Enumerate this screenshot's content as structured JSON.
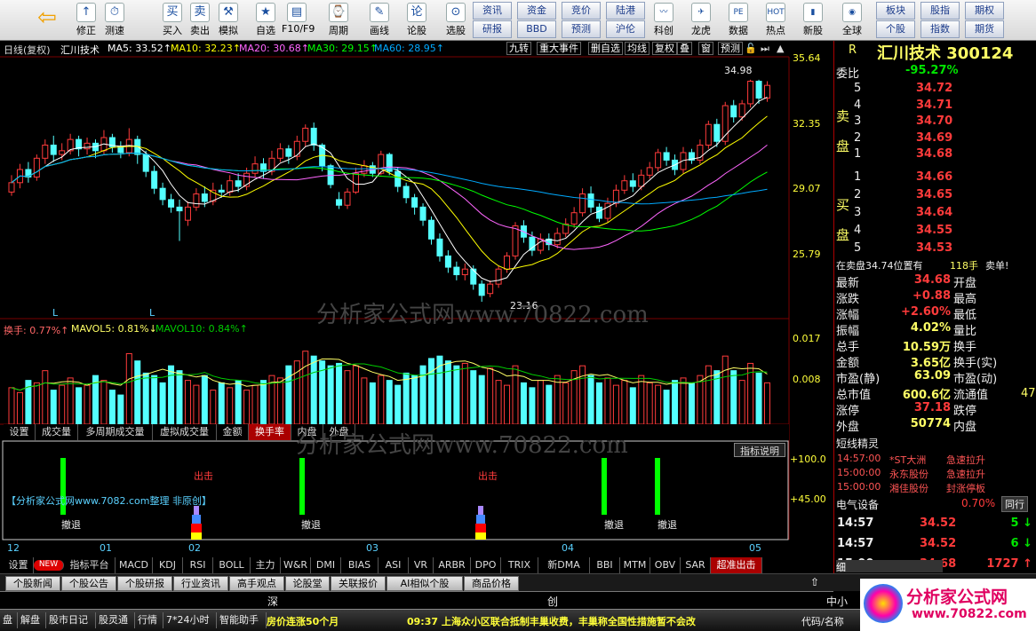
{
  "toolbar": {
    "left": [
      {
        "t": "修正",
        "i": "↑"
      },
      {
        "t": "测速",
        "i": "⏱"
      },
      {
        "t": "买入",
        "i": "买"
      },
      {
        "t": "卖出",
        "i": "卖"
      },
      {
        "t": "模拟",
        "i": "⚒"
      },
      {
        "t": "自选",
        "i": "★"
      },
      {
        "t": "F10/F9",
        "i": "▤"
      },
      {
        "t": "周期",
        "i": "⌚"
      },
      {
        "t": "画线",
        "i": "✎"
      },
      {
        "t": "论股",
        "i": "论"
      },
      {
        "t": "选股",
        "i": "⊙"
      }
    ],
    "btns": [
      "资讯",
      "资金",
      "竞价",
      "陆港",
      "研报",
      "BBD",
      "预测",
      "沪伦"
    ],
    "right": [
      {
        "t": "科创",
        "i": "〰"
      },
      {
        "t": "龙虎",
        "i": "✈"
      },
      {
        "t": "数据",
        "i": "PE"
      },
      {
        "t": "热点",
        "i": "HOT"
      },
      {
        "t": "新股",
        "i": "▮"
      },
      {
        "t": "全球",
        "i": "◉"
      }
    ],
    "btns2": [
      "板块",
      "股指",
      "期权",
      "个股",
      "指数",
      "期货"
    ]
  },
  "chart": {
    "header": {
      "title": "日线(复权)",
      "stock": "汇川技术",
      "ma5": "MA5: 33.52↑",
      "ma10": "MA10: 32.23↑",
      "ma20": "MA20: 30.68↑",
      "ma30": "MA30: 29.15↑",
      "ma60": "MA60: 28.95↑"
    },
    "top_btns": [
      "九转",
      "重大事件",
      "删自选",
      "均线",
      "复权",
      "叠",
      "窗",
      "预测"
    ],
    "price_ticks": [
      "35.64",
      "32.35",
      "29.07",
      "25.79"
    ],
    "hi_label": "34.98",
    "lo_label": "23.16",
    "watermark": "分析家公式网www.70822.com",
    "vol_header": {
      "a": "换手: 0.77%↑",
      "b": "MAVOL5: 0.81%↓",
      "c": "MAVOL10: 0.84%↑"
    },
    "vol_ticks": [
      "0.017",
      "0.008"
    ],
    "vol_tabs": [
      "设置",
      "成交量",
      "多周期成交量",
      "虚拟成交量",
      "金额",
      "换手率",
      "内盘",
      "外盘"
    ],
    "ind_button": "指标说明",
    "ind_ticks": [
      "+100.0",
      "+45.00"
    ],
    "ind_text": "【分析家公式网www.7082.com整理 非原创】",
    "ind_signals": [
      {
        "t": "撤退"
      },
      {
        "t": "撤退"
      },
      {
        "t": "撤退"
      },
      {
        "t": "撤退"
      }
    ],
    "exit_label": "出击",
    "months": [
      "12",
      "01",
      "02",
      "03",
      "04",
      "05"
    ],
    "ind_tabs": [
      "设置",
      "NEW",
      "指标平台",
      "MACD",
      "KDJ",
      "RSI",
      "BOLL",
      "主力",
      "W&R",
      "DMI",
      "BIAS",
      "ASI",
      "VR",
      "ARBR",
      "DPO",
      "TRIX",
      "新DMA",
      "BBI",
      "MTM",
      "OBV",
      "SAR",
      "超准出击"
    ]
  },
  "chart_data": {
    "type": "candlestick",
    "candles": [
      {
        "o": 29.0,
        "c": 29.5,
        "h": 29.9,
        "l": 28.8
      },
      {
        "o": 29.5,
        "c": 30.2,
        "h": 30.5,
        "l": 29.2
      },
      {
        "o": 30.2,
        "c": 29.8,
        "h": 30.6,
        "l": 29.5
      },
      {
        "o": 29.8,
        "c": 30.8,
        "h": 31.0,
        "l": 29.6
      },
      {
        "o": 30.8,
        "c": 31.5,
        "h": 31.8,
        "l": 30.5
      },
      {
        "o": 31.5,
        "c": 31.0,
        "h": 32.0,
        "l": 30.6
      },
      {
        "o": 31.0,
        "c": 31.2,
        "h": 31.6,
        "l": 30.7
      },
      {
        "o": 31.2,
        "c": 31.8,
        "h": 32.1,
        "l": 31.0
      },
      {
        "o": 31.8,
        "c": 31.3,
        "h": 32.0,
        "l": 30.9
      },
      {
        "o": 31.3,
        "c": 31.6,
        "h": 31.9,
        "l": 31.0
      },
      {
        "o": 31.6,
        "c": 31.2,
        "h": 31.8,
        "l": 30.8
      },
      {
        "o": 31.2,
        "c": 31.9,
        "h": 32.3,
        "l": 31.0
      },
      {
        "o": 31.9,
        "c": 31.4,
        "h": 32.1,
        "l": 31.1
      },
      {
        "o": 31.4,
        "c": 31.1,
        "h": 31.7,
        "l": 30.8
      },
      {
        "o": 31.1,
        "c": 31.8,
        "h": 32.4,
        "l": 30.9
      },
      {
        "o": 31.8,
        "c": 31.0,
        "h": 32.0,
        "l": 30.5
      },
      {
        "o": 31.0,
        "c": 30.1,
        "h": 31.2,
        "l": 29.8
      },
      {
        "o": 30.1,
        "c": 29.2,
        "h": 30.4,
        "l": 28.9
      },
      {
        "o": 29.2,
        "c": 28.6,
        "h": 29.5,
        "l": 28.3
      },
      {
        "o": 28.6,
        "c": 28.2,
        "h": 28.9,
        "l": 27.9
      },
      {
        "o": 28.2,
        "c": 28.0,
        "h": 28.6,
        "l": 26.4
      },
      {
        "o": 27.5,
        "c": 28.2,
        "h": 28.5,
        "l": 27.2
      },
      {
        "o": 28.2,
        "c": 28.9,
        "h": 29.2,
        "l": 28.0
      },
      {
        "o": 28.9,
        "c": 28.5,
        "h": 29.3,
        "l": 28.2
      },
      {
        "o": 28.5,
        "c": 29.1,
        "h": 29.5,
        "l": 28.3
      },
      {
        "o": 29.1,
        "c": 29.0,
        "h": 29.4,
        "l": 28.7
      },
      {
        "o": 29.0,
        "c": 29.6,
        "h": 29.9,
        "l": 28.8
      },
      {
        "o": 29.6,
        "c": 29.3,
        "h": 30.0,
        "l": 29.0
      },
      {
        "o": 29.3,
        "c": 30.0,
        "h": 30.3,
        "l": 29.1
      },
      {
        "o": 30.0,
        "c": 30.5,
        "h": 30.9,
        "l": 29.8
      },
      {
        "o": 30.5,
        "c": 30.1,
        "h": 30.8,
        "l": 29.7
      },
      {
        "o": 30.1,
        "c": 30.8,
        "h": 31.2,
        "l": 29.9
      },
      {
        "o": 30.8,
        "c": 31.3,
        "h": 31.6,
        "l": 30.6
      },
      {
        "o": 31.3,
        "c": 30.9,
        "h": 31.5,
        "l": 30.5
      },
      {
        "o": 30.9,
        "c": 31.7,
        "h": 32.0,
        "l": 30.7
      },
      {
        "o": 31.7,
        "c": 32.4,
        "h": 32.6,
        "l": 31.4
      },
      {
        "o": 32.4,
        "c": 31.5,
        "h": 32.7,
        "l": 31.2
      },
      {
        "o": 31.5,
        "c": 30.4,
        "h": 31.6,
        "l": 30.1
      },
      {
        "o": 30.4,
        "c": 29.4,
        "h": 30.5,
        "l": 29.2
      },
      {
        "o": 28.6,
        "c": 28.3,
        "h": 29.0,
        "l": 28.1
      },
      {
        "o": 28.3,
        "c": 29.0,
        "h": 29.2,
        "l": 28.1
      },
      {
        "o": 29.0,
        "c": 30.0,
        "h": 30.3,
        "l": 28.9
      },
      {
        "o": 30.0,
        "c": 30.4,
        "h": 30.7,
        "l": 29.8
      },
      {
        "o": 30.4,
        "c": 30.0,
        "h": 30.6,
        "l": 29.8
      },
      {
        "o": 30.0,
        "c": 31.0,
        "h": 31.2,
        "l": 29.9
      },
      {
        "o": 31.0,
        "c": 30.1,
        "h": 31.1,
        "l": 29.9
      },
      {
        "o": 30.1,
        "c": 29.3,
        "h": 30.3,
        "l": 29.0
      },
      {
        "o": 29.3,
        "c": 28.7,
        "h": 29.5,
        "l": 28.4
      },
      {
        "o": 28.7,
        "c": 28.2,
        "h": 28.9,
        "l": 27.8
      },
      {
        "o": 28.2,
        "c": 27.5,
        "h": 28.4,
        "l": 27.2
      },
      {
        "o": 27.5,
        "c": 26.5,
        "h": 27.7,
        "l": 26.2
      },
      {
        "o": 26.5,
        "c": 25.6,
        "h": 26.8,
        "l": 25.3
      },
      {
        "o": 25.6,
        "c": 25.0,
        "h": 25.9,
        "l": 24.7
      },
      {
        "o": 25.0,
        "c": 24.6,
        "h": 25.3,
        "l": 24.3
      },
      {
        "o": 24.6,
        "c": 24.9,
        "h": 25.2,
        "l": 24.3
      },
      {
        "o": 24.9,
        "c": 24.1,
        "h": 25.1,
        "l": 23.8
      },
      {
        "o": 24.1,
        "c": 23.5,
        "h": 24.3,
        "l": 23.16
      },
      {
        "o": 23.6,
        "c": 24.1,
        "h": 24.3,
        "l": 23.4
      },
      {
        "o": 24.1,
        "c": 24.9,
        "h": 25.1,
        "l": 23.9
      },
      {
        "o": 24.9,
        "c": 25.6,
        "h": 25.8,
        "l": 24.7
      },
      {
        "o": 25.6,
        "c": 27.2,
        "h": 27.4,
        "l": 25.4
      },
      {
        "o": 27.2,
        "c": 26.6,
        "h": 27.5,
        "l": 26.3
      },
      {
        "o": 26.6,
        "c": 25.9,
        "h": 26.9,
        "l": 25.6
      },
      {
        "o": 25.9,
        "c": 26.5,
        "h": 26.8,
        "l": 25.7
      },
      {
        "o": 26.5,
        "c": 26.2,
        "h": 26.8,
        "l": 25.9
      },
      {
        "o": 26.2,
        "c": 26.8,
        "h": 27.1,
        "l": 26.0
      },
      {
        "o": 26.8,
        "c": 27.3,
        "h": 27.6,
        "l": 26.6
      },
      {
        "o": 27.3,
        "c": 27.9,
        "h": 28.2,
        "l": 27.1
      },
      {
        "o": 27.9,
        "c": 28.9,
        "h": 29.2,
        "l": 27.7
      },
      {
        "o": 28.9,
        "c": 28.2,
        "h": 29.3,
        "l": 27.9
      },
      {
        "o": 28.2,
        "c": 27.6,
        "h": 28.4,
        "l": 27.4
      },
      {
        "o": 27.6,
        "c": 28.4,
        "h": 28.7,
        "l": 27.4
      },
      {
        "o": 28.4,
        "c": 29.1,
        "h": 29.4,
        "l": 28.2
      },
      {
        "o": 29.1,
        "c": 29.6,
        "h": 29.9,
        "l": 28.9
      },
      {
        "o": 29.6,
        "c": 29.3,
        "h": 30.0,
        "l": 29.0
      },
      {
        "o": 29.3,
        "c": 29.9,
        "h": 30.2,
        "l": 29.1
      },
      {
        "o": 29.9,
        "c": 30.3,
        "h": 30.6,
        "l": 29.7
      },
      {
        "o": 30.3,
        "c": 31.1,
        "h": 31.3,
        "l": 30.1
      },
      {
        "o": 31.1,
        "c": 30.7,
        "h": 31.4,
        "l": 30.4
      },
      {
        "o": 30.7,
        "c": 30.2,
        "h": 31.0,
        "l": 29.9
      },
      {
        "o": 30.2,
        "c": 31.1,
        "h": 31.4,
        "l": 30.0
      },
      {
        "o": 31.1,
        "c": 30.7,
        "h": 31.3,
        "l": 30.5
      },
      {
        "o": 30.7,
        "c": 31.5,
        "h": 31.8,
        "l": 30.5
      },
      {
        "o": 31.5,
        "c": 32.6,
        "h": 32.8,
        "l": 31.3
      },
      {
        "o": 32.6,
        "c": 31.7,
        "h": 32.9,
        "l": 31.4
      },
      {
        "o": 31.7,
        "c": 33.6,
        "h": 33.8,
        "l": 31.5
      },
      {
        "o": 33.6,
        "c": 33.0,
        "h": 33.9,
        "l": 32.7
      },
      {
        "o": 33.0,
        "c": 33.7,
        "h": 33.9,
        "l": 32.8
      },
      {
        "o": 33.7,
        "c": 34.9,
        "h": 34.98,
        "l": 33.5
      },
      {
        "o": 34.9,
        "c": 34.0,
        "h": 34.98,
        "l": 33.7
      },
      {
        "o": 34.0,
        "c": 34.68,
        "h": 34.9,
        "l": 33.8
      }
    ],
    "vol": [
      0.0075,
      0.0065,
      0.009,
      0.0085,
      0.011,
      0.007,
      0.008,
      0.0095,
      0.0075,
      0.008,
      0.01,
      0.009,
      0.007,
      0.006,
      0.0145,
      0.013,
      0.0105,
      0.01,
      0.0085,
      0.012,
      0.011,
      0.009,
      0.008,
      0.01,
      0.007,
      0.0085,
      0.0075,
      0.009,
      0.007,
      0.008,
      0.009,
      0.01,
      0.0095,
      0.012,
      0.013,
      0.015,
      0.014,
      0.013,
      0.012,
      0.0125,
      0.011,
      0.012,
      0.0095,
      0.0085,
      0.01,
      0.009,
      0.008,
      0.0105,
      0.01,
      0.012,
      0.0135,
      0.014,
      0.013,
      0.012,
      0.0125,
      0.011,
      0.01,
      0.0115,
      0.009,
      0.008,
      0.012,
      0.0085,
      0.0075,
      0.009,
      0.008,
      0.01,
      0.0085,
      0.011,
      0.012,
      0.01,
      0.0085,
      0.0095,
      0.008,
      0.009,
      0.0075,
      0.01,
      0.0085,
      0.008,
      0.007,
      0.009,
      0.0095,
      0.0085,
      0.01,
      0.012,
      0.011,
      0.014,
      0.011,
      0.009,
      0.0125,
      0.0105,
      0.0085
    ],
    "ma_colors": [
      "#ffffff",
      "#ffff00",
      "#ff66ff",
      "#00ff00",
      "#00aaff"
    ]
  },
  "right_panel": {
    "code_prefix": "R",
    "name_code": "汇川技术 300124",
    "weibi_label": "委比",
    "weibi": "-95.27%",
    "sell_label": "卖盘",
    "buy_label": "买盘",
    "sell": [
      {
        "n": "5",
        "p": "34.72"
      },
      {
        "n": "4",
        "p": "34.71"
      },
      {
        "n": "3",
        "p": "34.70"
      },
      {
        "n": "2",
        "p": "34.69"
      },
      {
        "n": "1",
        "p": "34.68"
      }
    ],
    "buy": [
      {
        "n": "1",
        "p": "34.66"
      },
      {
        "n": "2",
        "p": "34.65"
      },
      {
        "n": "3",
        "p": "34.64"
      },
      {
        "n": "4",
        "p": "34.55"
      },
      {
        "n": "5",
        "p": "34.53"
      }
    ],
    "info_line": {
      "a": "在卖盘34.74位置有",
      "b": "118手",
      "c": "卖单!"
    },
    "stats": [
      {
        "l": "最新",
        "v": "34.68",
        "r": "开盘"
      },
      {
        "l": "涨跌",
        "v": "+0.88",
        "r": "最高"
      },
      {
        "l": "涨幅",
        "v": "+2.60%",
        "r": "最低"
      },
      {
        "l": "振幅",
        "v": "4.02%",
        "r": "量比"
      },
      {
        "l": "总手",
        "v": "10.59万",
        "r": "换手"
      },
      {
        "l": "金额",
        "v": "3.65亿",
        "r": "换手(实)"
      },
      {
        "l": "市盈(静)",
        "v": "63.09",
        "r": "市盈(动)"
      },
      {
        "l": "总市值",
        "v": "600.6亿",
        "r": "流通值"
      },
      {
        "l": "涨停",
        "v": "37.18",
        "r": "跌停"
      },
      {
        "l": "外盘",
        "v": "50774",
        "r": "内盘"
      }
    ],
    "stat_extra": "47",
    "jingling_title": "短线精灵",
    "jingling": [
      {
        "t": "14:57:00",
        "s": "*ST大洲",
        "e": "急速拉升"
      },
      {
        "t": "15:00:00",
        "s": "永东股份",
        "e": "急速拉升"
      },
      {
        "t": "15:00:00",
        "s": "湘佳股份",
        "e": "封涨停板"
      }
    ],
    "sector": {
      "name": "电气设备",
      "pct": "0.70%",
      "tab": "同行"
    },
    "ticks": [
      {
        "t": "14:57",
        "p": "34.52",
        "v": "5",
        "d": "↓"
      },
      {
        "t": "14:57",
        "p": "34.52",
        "v": "6",
        "d": "↓"
      },
      {
        "t": "15:00",
        "p": "34.68",
        "v": "1727",
        "d": "↑"
      }
    ],
    "bottom_tab": "细"
  },
  "bottom_tabs": [
    "个股新闻",
    "个股公告",
    "个股研报",
    "行业资讯",
    "高手观点",
    "论股堂",
    "关联报价",
    "AI相似个股",
    "商品价格"
  ],
  "indexbar": {
    "a": "深",
    "b": "创",
    "c": "中小"
  },
  "statusbar": {
    "btns": [
      "盘",
      "解盘",
      "股市日记",
      "股灵通",
      "行情",
      "7*24小时",
      "智能助手"
    ],
    "news1": "房价连涨50个月",
    "news2": "09:37 上海众小区联合抵制丰巢收费，丰巢称全国性措施暂不会改",
    "right": "代码/名称"
  },
  "logo": {
    "text": "分析家公式网",
    "url": "www.70822.com"
  }
}
